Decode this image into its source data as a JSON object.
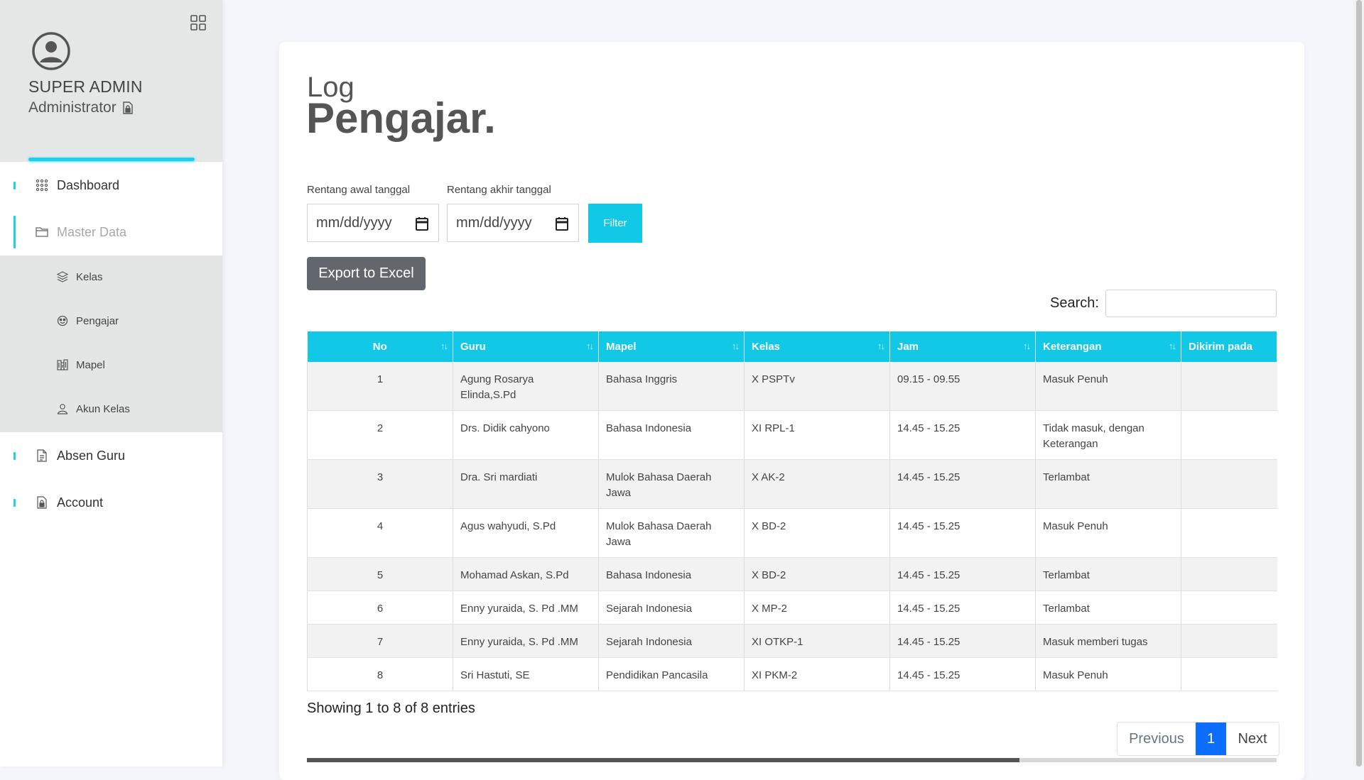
{
  "sidebar": {
    "profile": {
      "name": "SUPER ADMIN",
      "role": "Administrator"
    },
    "nav": {
      "dashboard": "Dashboard",
      "master_data": "Master Data",
      "sub": {
        "kelas": "Kelas",
        "pengajar": "Pengajar",
        "mapel": "Mapel",
        "akun_kelas": "Akun Kelas"
      },
      "absen_guru": "Absen Guru",
      "account": "Account"
    }
  },
  "main": {
    "title_small": "Log",
    "title_big": "Pengajar.",
    "filter": {
      "start_label": "Rentang awal tanggal",
      "end_label": "Rentang akhir tanggal",
      "start_value": "mm/dd/yyyy",
      "end_value": "mm/dd/yyyy",
      "filter_button": "Filter"
    },
    "export_button": "Export to Excel",
    "search_label": "Search:",
    "search_value": "",
    "table": {
      "headers": [
        "No",
        "Guru",
        "Mapel",
        "Kelas",
        "Jam",
        "Keterangan",
        "Dikirim pada"
      ],
      "rows": [
        [
          "1",
          "Agung Rosarya Elinda,S.Pd",
          "Bahasa Inggris",
          "X PSPTv",
          "09.15 - 09.55",
          "Masuk Penuh",
          ""
        ],
        [
          "2",
          "Drs. Didik cahyono",
          "Bahasa Indonesia",
          "XI RPL-1",
          "14.45 - 15.25",
          "Tidak masuk, dengan Keterangan",
          ""
        ],
        [
          "3",
          "Dra. Sri mardiati",
          "Mulok Bahasa Daerah Jawa",
          "X AK-2",
          "14.45 - 15.25",
          "Terlambat",
          ""
        ],
        [
          "4",
          "Agus wahyudi, S.Pd",
          "Mulok Bahasa Daerah Jawa",
          "X BD-2",
          "14.45 - 15.25",
          "Masuk Penuh",
          ""
        ],
        [
          "5",
          "Mohamad Askan, S.Pd",
          "Bahasa Indonesia",
          "X BD-2",
          "14.45 - 15.25",
          "Terlambat",
          ""
        ],
        [
          "6",
          "Enny yuraida, S. Pd .MM",
          "Sejarah Indonesia",
          "X MP-2",
          "14.45 - 15.25",
          "Terlambat",
          ""
        ],
        [
          "7",
          "Enny yuraida, S. Pd .MM",
          "Sejarah Indonesia",
          "XI OTKP-1",
          "14.45 - 15.25",
          "Masuk memberi tugas",
          ""
        ],
        [
          "8",
          "Sri Hastuti, SE",
          "Pendidikan Pancasila",
          "XI PKM-2",
          "14.45 - 15.25",
          "Masuk Penuh",
          ""
        ]
      ]
    },
    "info": "Showing 1 to 8 of 8 entries",
    "pagination": {
      "previous": "Previous",
      "current": "1",
      "next": "Next"
    }
  },
  "colors": {
    "accent": "#11c8e6",
    "page_active": "#0d6efd",
    "export_bg": "#61676d"
  },
  "icons": {
    "grid": "grid-icon",
    "avatar": "user-circle-icon",
    "role": "file-lock-icon",
    "dashboard": "dots-grid-icon",
    "master": "folder-icon",
    "kelas": "layers-icon",
    "pengajar": "face-icon",
    "mapel": "building-icon",
    "akun_kelas": "user-icon",
    "absen": "document-icon",
    "account": "file-lock-icon",
    "date": "calendar-icon"
  }
}
